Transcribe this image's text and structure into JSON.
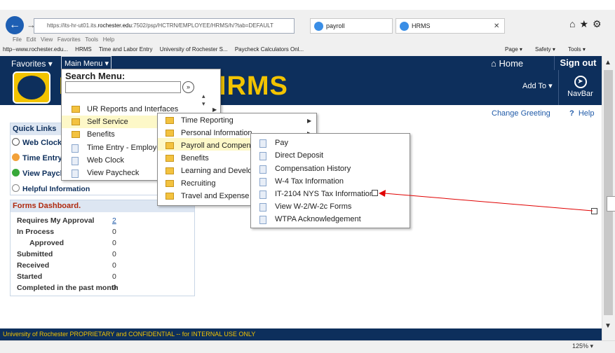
{
  "browser": {
    "url_prefix": "https://its-hr-ut01.its.",
    "url_host": "rochester.edu",
    "url_rest": ":7502/psp/HCTRN/EMPLOYEE/HRMS/h/?tab=DEFAULT",
    "tab1": "payroll",
    "tab2": "HRMS",
    "menu_items": [
      "File",
      "Edit",
      "View",
      "Favorites",
      "Tools",
      "Help"
    ],
    "favorites": [
      "http--www.rochester.edu...",
      "HRMS",
      "Time and Labor Entry",
      "University of Rochester S...",
      "Paycheck Calculators Onl..."
    ],
    "right_tools": [
      "Page ▾",
      "Safety ▾",
      "Tools ▾"
    ],
    "zoom": "125%"
  },
  "app": {
    "favorites_label": "Favorites",
    "main_menu_label": "Main Menu",
    "home_label": "Home",
    "signout_label": "Sign out",
    "title": "HRMS",
    "add_to_label": "Add To",
    "navbar_label": "NavBar",
    "change_greeting": "Change Greeting",
    "help": "Help"
  },
  "quick_links": {
    "title": "Quick Links",
    "items": [
      "Web Clock",
      "Time Entry -",
      "View Payche",
      "Helpful Information"
    ]
  },
  "forms_dashboard": {
    "title": "Forms Dashboard.",
    "rows": [
      {
        "label": "Requires My Approval",
        "value": "2"
      },
      {
        "label": "In Process",
        "value": "0"
      },
      {
        "label": "Approved",
        "value": "0"
      },
      {
        "label": "Submitted",
        "value": "0"
      },
      {
        "label": "Received",
        "value": "0"
      },
      {
        "label": "Started",
        "value": "0"
      },
      {
        "label": "Completed in the past month",
        "value": "0"
      }
    ]
  },
  "main_menu": {
    "search_label": "Search Menu:",
    "items": [
      "UR Reports and Interfaces",
      "Self Service",
      "Benefits",
      "Time Entry - Employee",
      "Web Clock",
      "View Paycheck"
    ]
  },
  "self_service_menu": {
    "items": [
      "Time Reporting",
      "Personal Information",
      "Payroll and Compensati",
      "Benefits",
      "Learning and Developm",
      "Recruiting",
      "Travel and Expense"
    ]
  },
  "payroll_menu": {
    "items": [
      "Pay",
      "Direct Deposit",
      "Compensation History",
      "W-4 Tax Information",
      "IT-2104 NYS Tax Information",
      "View W-2/W-2c Forms",
      "WTPA Acknowledgement"
    ]
  },
  "footer": "University of Rochester PROPRIETARY and CONFIDENTIAL -- for INTERNAL USE ONLY",
  "colors": {
    "navy": "#0d2f5c",
    "gold": "#f2c300",
    "annotation_red": "#e00000"
  }
}
